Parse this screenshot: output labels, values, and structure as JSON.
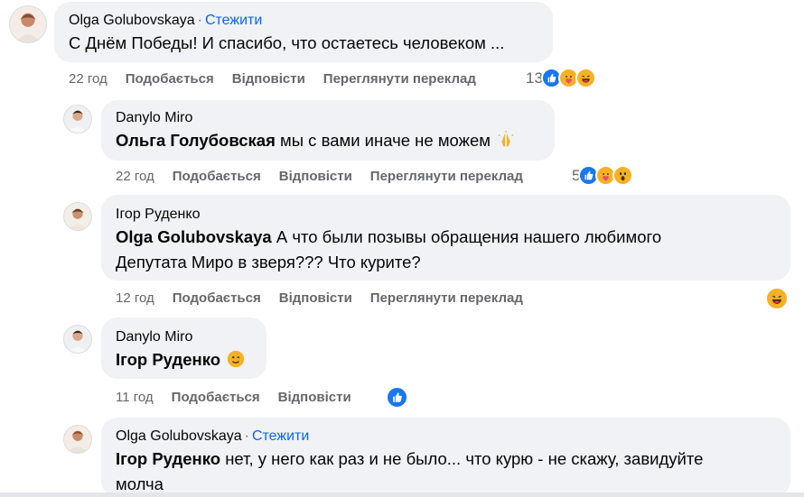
{
  "comments": [
    {
      "author": "Olga Golubovskaya",
      "dot": "·",
      "follow": "Стежити",
      "mention": "",
      "text": "С Днём Победы! И спасибо, что остаетесь человеком ...",
      "time": "22 год",
      "like": "Подобається",
      "reply": "Відповісти",
      "translate": "Переглянути переклад",
      "reaction_count": "13",
      "reactions": [
        "like-icon",
        "care-icon",
        "haha-icon"
      ]
    },
    {
      "author": "Danylo Miro",
      "mention": "Ольга Голубовская",
      "text": "мы с вами иначе не можем",
      "emoji": "praying-hands-icon",
      "time": "22 год",
      "like": "Подобається",
      "reply": "Відповісти",
      "translate": "Переглянути переклад",
      "reaction_count": "5",
      "reactions": [
        "like-icon",
        "care-icon",
        "wow-icon"
      ]
    },
    {
      "author": "Ігор Руденко",
      "mention": "Olga Golubovskaya",
      "text_line1": "А что были позывы обращения нашего любимого",
      "text_line2": "Депутата Миро в зверя??? Что курите?",
      "time": "12 год",
      "like": "Подобається",
      "reply": "Відповісти",
      "translate": "Переглянути переклад",
      "reactions": [
        "haha-icon"
      ]
    },
    {
      "author": "Danylo Miro",
      "mention": "Ігор Руденко",
      "emoji": "wink-icon",
      "time": "11 год",
      "like": "Подобається",
      "reply": "Відповісти",
      "reactions": [
        "like-icon"
      ]
    },
    {
      "author": "Olga Golubovskaya",
      "dot": "·",
      "follow": "Стежити",
      "mention": "Ігор Руденко",
      "text_line1": "нет, у него как раз и не было... что курю - не скажу, завидуйте",
      "text_line2": "молча"
    }
  ],
  "colors": {
    "bubble": "#f0f2f5",
    "link": "#0866ff",
    "meta": "#65676b",
    "like": "#1877f2",
    "emoji": "#f7b125"
  }
}
